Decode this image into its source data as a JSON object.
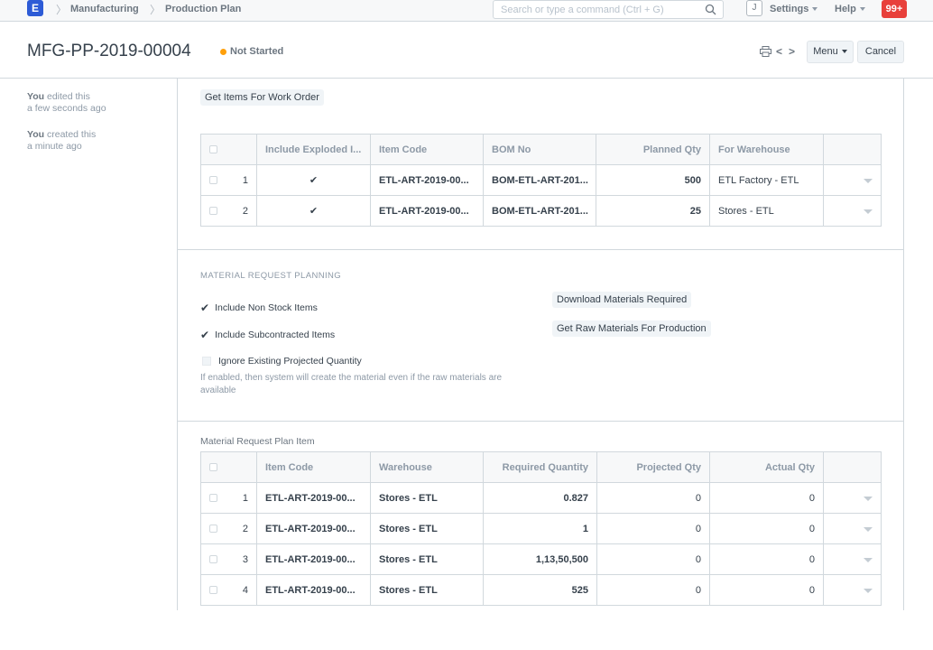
{
  "navbar": {
    "logo_letter": "E",
    "breadcrumbs": [
      "Manufacturing",
      "Production Plan"
    ],
    "search_placeholder": "Search or type a command (Ctrl + G)",
    "avatar_letter": "J",
    "settings_label": "Settings",
    "help_label": "Help",
    "notification_count": "99+"
  },
  "page": {
    "title": "MFG-PP-2019-00004",
    "status": "Not Started",
    "menu_label": "Menu",
    "cancel_label": "Cancel"
  },
  "sidebar": {
    "activity": [
      {
        "who": "You",
        "action": " edited this",
        "when": "a few seconds ago"
      },
      {
        "who": "You",
        "action": " created this",
        "when": "a minute ago"
      }
    ]
  },
  "form": {
    "get_items_label": "Get Items For Work Order",
    "items_table": {
      "headers": [
        "Include Exploded I...",
        "Item Code",
        "BOM No",
        "Planned Qty",
        "For Warehouse"
      ],
      "rows": [
        {
          "idx": "1",
          "exploded": "✔",
          "item_code": "ETL-ART-2019-00...",
          "bom_no": "BOM-ETL-ART-201...",
          "planned_qty": "500",
          "warehouse": "ETL Factory - ETL"
        },
        {
          "idx": "2",
          "exploded": "✔",
          "item_code": "ETL-ART-2019-00...",
          "bom_no": "BOM-ETL-ART-201...",
          "planned_qty": "25",
          "warehouse": "Stores - ETL"
        }
      ]
    },
    "mrp": {
      "section_title": "MATERIAL REQUEST PLANNING",
      "include_non_stock": "Include Non Stock Items",
      "include_subcontracted": "Include Subcontracted Items",
      "ignore_projected": "Ignore Existing Projected Quantity",
      "ignore_help_1": "If enabled, then system will create the material even if the raw materials are",
      "ignore_help_2": "available",
      "download_label": "Download Materials Required",
      "get_raw_label": "Get Raw Materials For Production"
    },
    "mr_table": {
      "label": "Material Request Plan Item",
      "headers": [
        "Item Code",
        "Warehouse",
        "Required Quantity",
        "Projected Qty",
        "Actual Qty"
      ],
      "rows": [
        {
          "idx": "1",
          "item_code": "ETL-ART-2019-00...",
          "warehouse": "Stores - ETL",
          "required": "0.827",
          "projected": "0",
          "actual": "0"
        },
        {
          "idx": "2",
          "item_code": "ETL-ART-2019-00...",
          "warehouse": "Stores - ETL",
          "required": "1",
          "projected": "0",
          "actual": "0"
        },
        {
          "idx": "3",
          "item_code": "ETL-ART-2019-00...",
          "warehouse": "Stores - ETL",
          "required": "1,13,50,500",
          "projected": "0",
          "actual": "0"
        },
        {
          "idx": "4",
          "item_code": "ETL-ART-2019-00...",
          "warehouse": "Stores - ETL",
          "required": "525",
          "projected": "0",
          "actual": "0"
        }
      ]
    }
  }
}
